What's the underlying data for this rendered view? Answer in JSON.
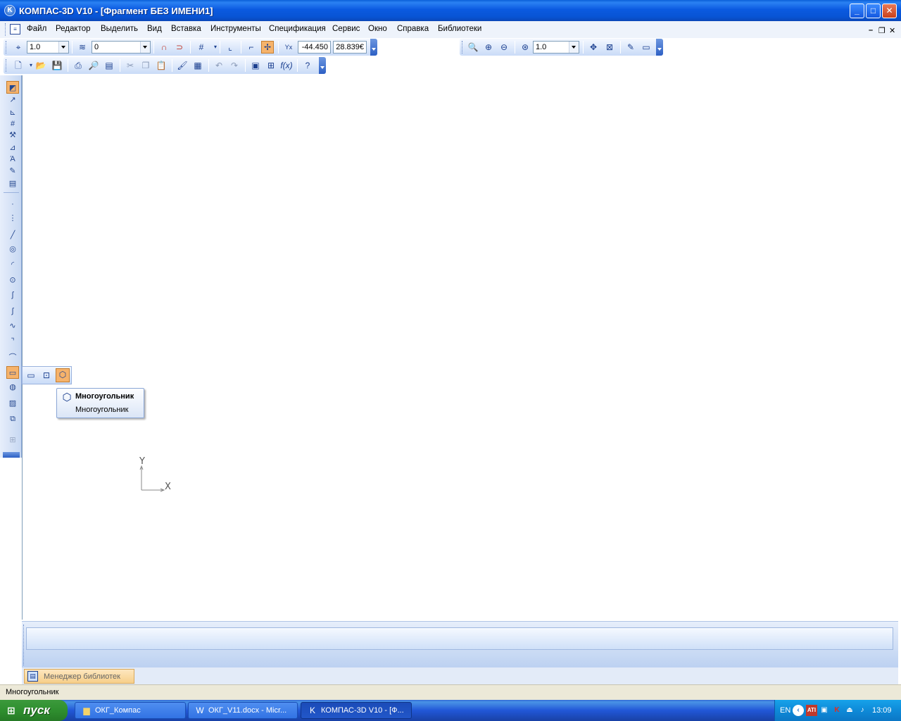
{
  "window": {
    "title": "КОМПАС-3D V10 - [Фрагмент БЕЗ ИМЕНИ1]",
    "minimize_label": "_",
    "maximize_label": "□",
    "close_label": "✕"
  },
  "menu": {
    "items": [
      "Файл",
      "Редактор",
      "Выделить",
      "Вид",
      "Вставка",
      "Инструменты",
      "Спецификация",
      "Сервис",
      "Окно",
      "Справка",
      "Библиотеки"
    ],
    "mdi_minimize": "–",
    "mdi_restore": "❐",
    "mdi_close": "✕"
  },
  "toolbar_current": {
    "step_value": "1.0",
    "layer_value": "0",
    "coord_x": "-44.450",
    "coord_y": "28.839€"
  },
  "toolbar_view": {
    "zoom_value": "1.0"
  },
  "flyout": {
    "items": [
      "rectangle",
      "rectangle-center",
      "polygon"
    ]
  },
  "tooltip": {
    "title": "Многоугольник",
    "description": "Многоугольник"
  },
  "axes": {
    "x_label": "X",
    "y_label": "Y"
  },
  "library_tab": {
    "label": "Менеджер библиотек"
  },
  "status": {
    "text": "Многоугольник"
  },
  "taskbar": {
    "start_label": "пуск",
    "tasks": [
      {
        "label": "ОКГ_Компас",
        "icon": "folder-icon",
        "active": false
      },
      {
        "label": "ОКГ_V11.docx - Micr...",
        "icon": "word-icon",
        "active": false
      },
      {
        "label": "КОМПАС-3D V10 - [Ф...",
        "icon": "kompas-icon",
        "active": true
      }
    ],
    "tray_lang": "EN",
    "tray_ati": "ATI",
    "tray_k": "K",
    "clock": "13:09"
  },
  "colors": {
    "titlebar": "#0b5ae0",
    "active_tool": "#f6b36b",
    "toolbar_bg": "#c9dbf7",
    "taskbar": "#2157d7",
    "start": "#2f8f2f"
  }
}
